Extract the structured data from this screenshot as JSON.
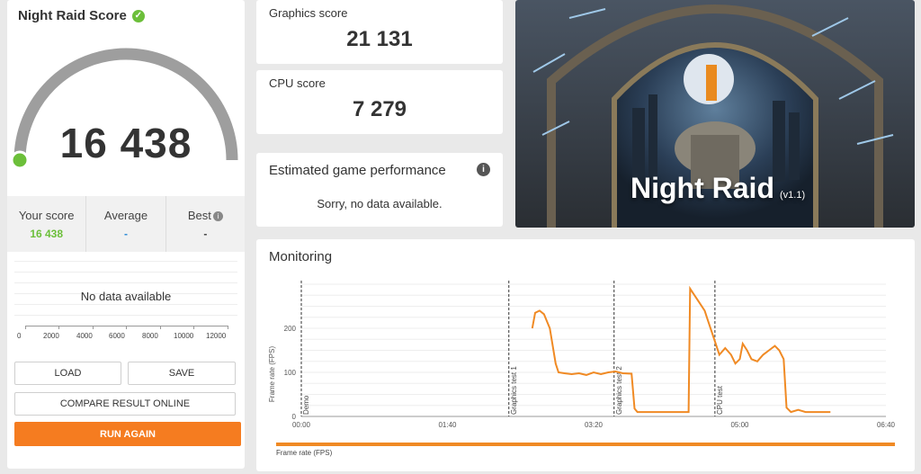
{
  "left_panel": {
    "title": "Night Raid Score",
    "score": "16 438",
    "stats": {
      "your_score_label": "Your score",
      "your_score_value": "16 438",
      "average_label": "Average",
      "average_value": "-",
      "best_label": "Best",
      "best_value": "-"
    },
    "histogram": {
      "no_data": "No data available",
      "ticks": [
        "0",
        "2000",
        "4000",
        "6000",
        "8000",
        "10000",
        "12000"
      ]
    },
    "buttons": {
      "load": "LOAD",
      "save": "SAVE",
      "compare": "COMPARE RESULT ONLINE",
      "run_again": "RUN AGAIN"
    }
  },
  "graphics": {
    "label": "Graphics score",
    "value": "21 131"
  },
  "cpu": {
    "label": "CPU score",
    "value": "7 279"
  },
  "estimated": {
    "title": "Estimated game performance",
    "message": "Sorry, no data available."
  },
  "hero": {
    "title": "Night Raid",
    "version": "(v1.1)"
  },
  "monitoring": {
    "title": "Monitoring",
    "chart_data": {
      "type": "line",
      "ylabel": "Frame rate (FPS)",
      "legend": "Frame rate (FPS)",
      "y_ticks": [
        "0",
        "100",
        "200"
      ],
      "x_ticks": [
        "00:00",
        "01:40",
        "03:20",
        "05:00",
        "06:40"
      ],
      "markers": [
        "Demo",
        "Graphics test 1",
        "Graphics test 2",
        "CPU test"
      ],
      "series": [
        {
          "name": "Frame rate (FPS)",
          "color": "#f08a24",
          "points": [
            [
              158,
              200
            ],
            [
              160,
              235
            ],
            [
              163,
              240
            ],
            [
              166,
              232
            ],
            [
              170,
              200
            ],
            [
              174,
              120
            ],
            [
              176,
              100
            ],
            [
              180,
              98
            ],
            [
              185,
              96
            ],
            [
              190,
              98
            ],
            [
              195,
              94
            ],
            [
              200,
              100
            ],
            [
              205,
              96
            ],
            [
              210,
              100
            ],
            [
              215,
              102
            ],
            [
              220,
              98
            ],
            [
              226,
              97
            ],
            [
              228,
              18
            ],
            [
              230,
              10
            ],
            [
              240,
              10
            ],
            [
              250,
              10
            ],
            [
              260,
              10
            ],
            [
              265,
              10
            ],
            [
              266,
              290
            ],
            [
              268,
              280
            ],
            [
              272,
              260
            ],
            [
              276,
              240
            ],
            [
              278,
              220
            ],
            [
              282,
              180
            ],
            [
              286,
              140
            ],
            [
              290,
              155
            ],
            [
              294,
              140
            ],
            [
              297,
              120
            ],
            [
              300,
              130
            ],
            [
              302,
              165
            ],
            [
              305,
              150
            ],
            [
              308,
              130
            ],
            [
              312,
              125
            ],
            [
              316,
              140
            ],
            [
              320,
              150
            ],
            [
              324,
              160
            ],
            [
              327,
              150
            ],
            [
              330,
              130
            ],
            [
              332,
              20
            ],
            [
              335,
              10
            ],
            [
              340,
              15
            ],
            [
              345,
              10
            ],
            [
              355,
              10
            ],
            [
              362,
              10
            ]
          ]
        }
      ]
    }
  }
}
